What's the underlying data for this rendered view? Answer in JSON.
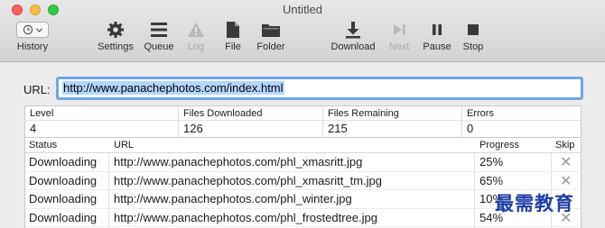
{
  "window": {
    "title": "Untitled"
  },
  "toolbar": {
    "history": "History",
    "settings": "Settings",
    "queue": "Queue",
    "log": "Log",
    "file": "File",
    "folder": "Folder",
    "download": "Download",
    "next": "Next",
    "pause": "Pause",
    "stop": "Stop"
  },
  "url_field": {
    "label": "URL:",
    "value": "http://www.panachephotos.com/index.html"
  },
  "stats": {
    "headers": [
      "Level",
      "Files Downloaded",
      "Files Remaining",
      "Errors"
    ],
    "values": [
      "4",
      "126",
      "215",
      "0"
    ]
  },
  "list": {
    "headers": [
      "Status",
      "URL",
      "Progress",
      "Skip"
    ],
    "rows": [
      {
        "status": "Downloading",
        "url": "http://www.panachephotos.com/phl_xmasritt.jpg",
        "progress": "25%"
      },
      {
        "status": "Downloading",
        "url": "http://www.panachephotos.com/phl_xmasritt_tm.jpg",
        "progress": "65%"
      },
      {
        "status": "Downloading",
        "url": "http://www.panachephotos.com/phl_winter.jpg",
        "progress": "10%"
      },
      {
        "status": "Downloading",
        "url": "http://www.panachephotos.com/phl_frostedtree.jpg",
        "progress": "54%"
      }
    ]
  },
  "watermark": "最需教育"
}
